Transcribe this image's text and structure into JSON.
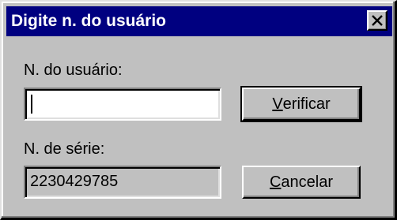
{
  "window": {
    "title": "Digite n. do usuário",
    "close_icon": "close-x-icon"
  },
  "user_number": {
    "label": "N. do usuário:",
    "value": "",
    "placeholder": ""
  },
  "serial_number": {
    "label": "N. de série:",
    "value": "2230429785"
  },
  "buttons": {
    "verify": {
      "hotkey": "V",
      "rest": "erificar"
    },
    "cancel": {
      "hotkey": "C",
      "rest": "ancelar"
    }
  },
  "colors": {
    "titlebar": "#000080",
    "dialog_bg": "#c0c0c0",
    "field_bg": "#ffffff",
    "readonly_bg": "#c0c0c0"
  }
}
